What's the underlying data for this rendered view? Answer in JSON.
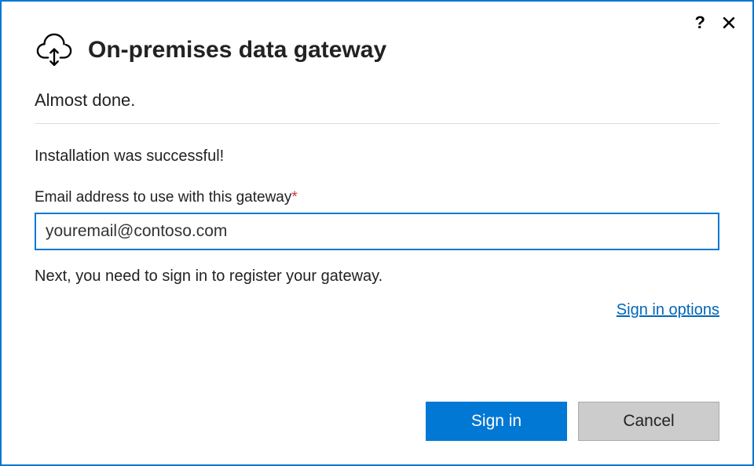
{
  "titlebar": {
    "help": "?",
    "close": "✕"
  },
  "header": {
    "title": "On-premises data gateway"
  },
  "subtitle": "Almost done.",
  "success_message": "Installation was successful!",
  "email": {
    "label": "Email address to use with this gateway",
    "required_mark": "*",
    "value": "youremail@contoso.com"
  },
  "next_message": "Next, you need to sign in to register your gateway.",
  "signin_options_link": "Sign in options",
  "buttons": {
    "signin": "Sign in",
    "cancel": "Cancel"
  }
}
